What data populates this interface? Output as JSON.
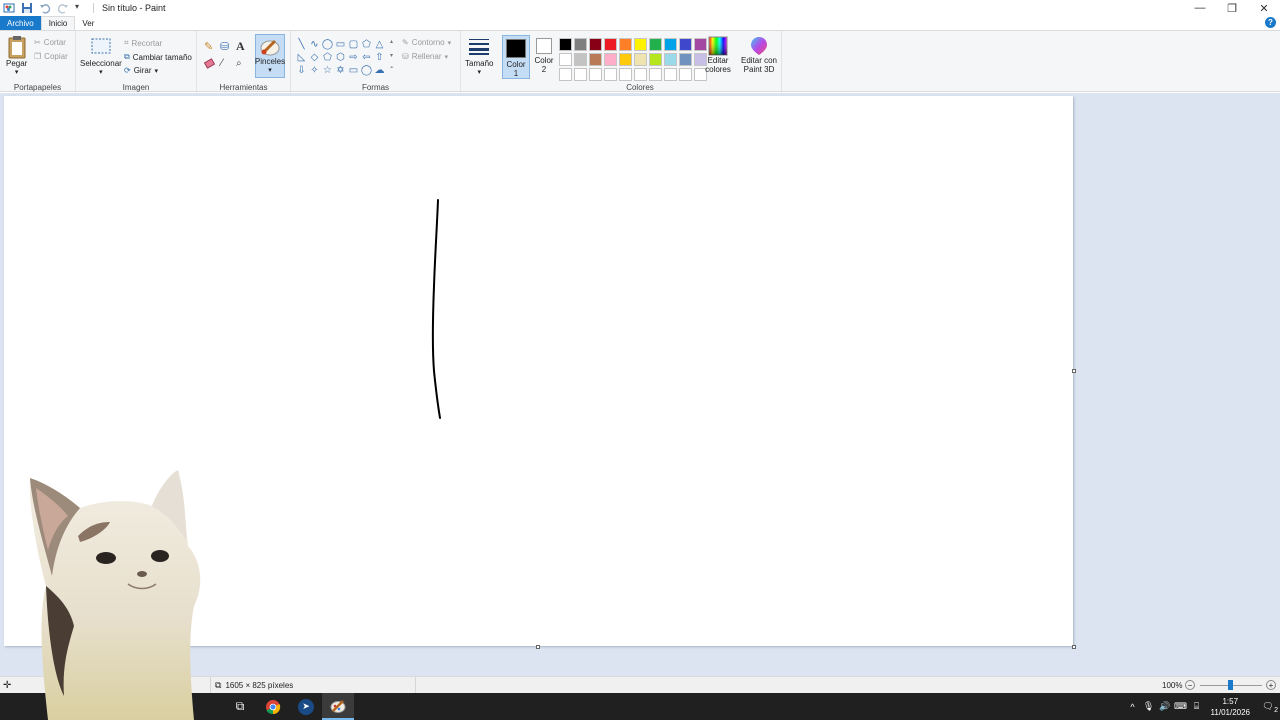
{
  "window": {
    "title": "Sin título - Paint",
    "controls": {
      "minimize": "—",
      "restore": "❐",
      "close": "✕"
    }
  },
  "menu": {
    "tabs": [
      "Archivo",
      "Inicio",
      "Ver"
    ],
    "help": "?"
  },
  "ribbon": {
    "clipboard": {
      "label": "Portapapeles",
      "paste": "Pegar",
      "cut": "Cortar",
      "copy": "Copiar"
    },
    "image": {
      "label": "Imagen",
      "select": "Seleccionar",
      "crop": "Recortar",
      "resize": "Cambiar tamaño",
      "rotate": "Girar"
    },
    "tools": {
      "label": "Herramientas",
      "brushes": "Pinceles"
    },
    "shapes": {
      "label": "Formas",
      "outline": "Contorno",
      "fill": "Rellenar"
    },
    "size": {
      "label": "Tamaño"
    },
    "colors": {
      "label": "Colores",
      "color1_line1": "Color",
      "color1_line2": "1",
      "color2_line1": "Color",
      "color2_line2": "2",
      "edit_line1": "Editar",
      "edit_line2": "colores",
      "paint3d_line1": "Editar con",
      "paint3d_line2": "Paint 3D",
      "color1_value": "#000000",
      "color2_value": "#ffffff",
      "palette": [
        "#000000",
        "#7f7f7f",
        "#880015",
        "#ed1c24",
        "#ff7f27",
        "#fff200",
        "#22b14c",
        "#00a2e8",
        "#3f48cc",
        "#a349a4",
        "#ffffff",
        "#c3c3c3",
        "#b97a57",
        "#ffaec9",
        "#ffc90e",
        "#efe4b0",
        "#b5e61d",
        "#99d9ea",
        "#7092be",
        "#c8bfe7",
        "#ffffff",
        "#ffffff",
        "#ffffff",
        "#ffffff",
        "#ffffff",
        "#ffffff",
        "#ffffff",
        "#ffffff",
        "#ffffff",
        "#ffffff"
      ]
    }
  },
  "status": {
    "dimensions": "1605 × 825 píxeles",
    "zoom": "100%",
    "zoom_out": "−",
    "zoom_in": "+",
    "zoom_fraction": 0.5
  },
  "taskbar": {
    "time": "1:57",
    "date": "11/01/2026",
    "notifications": "2"
  }
}
